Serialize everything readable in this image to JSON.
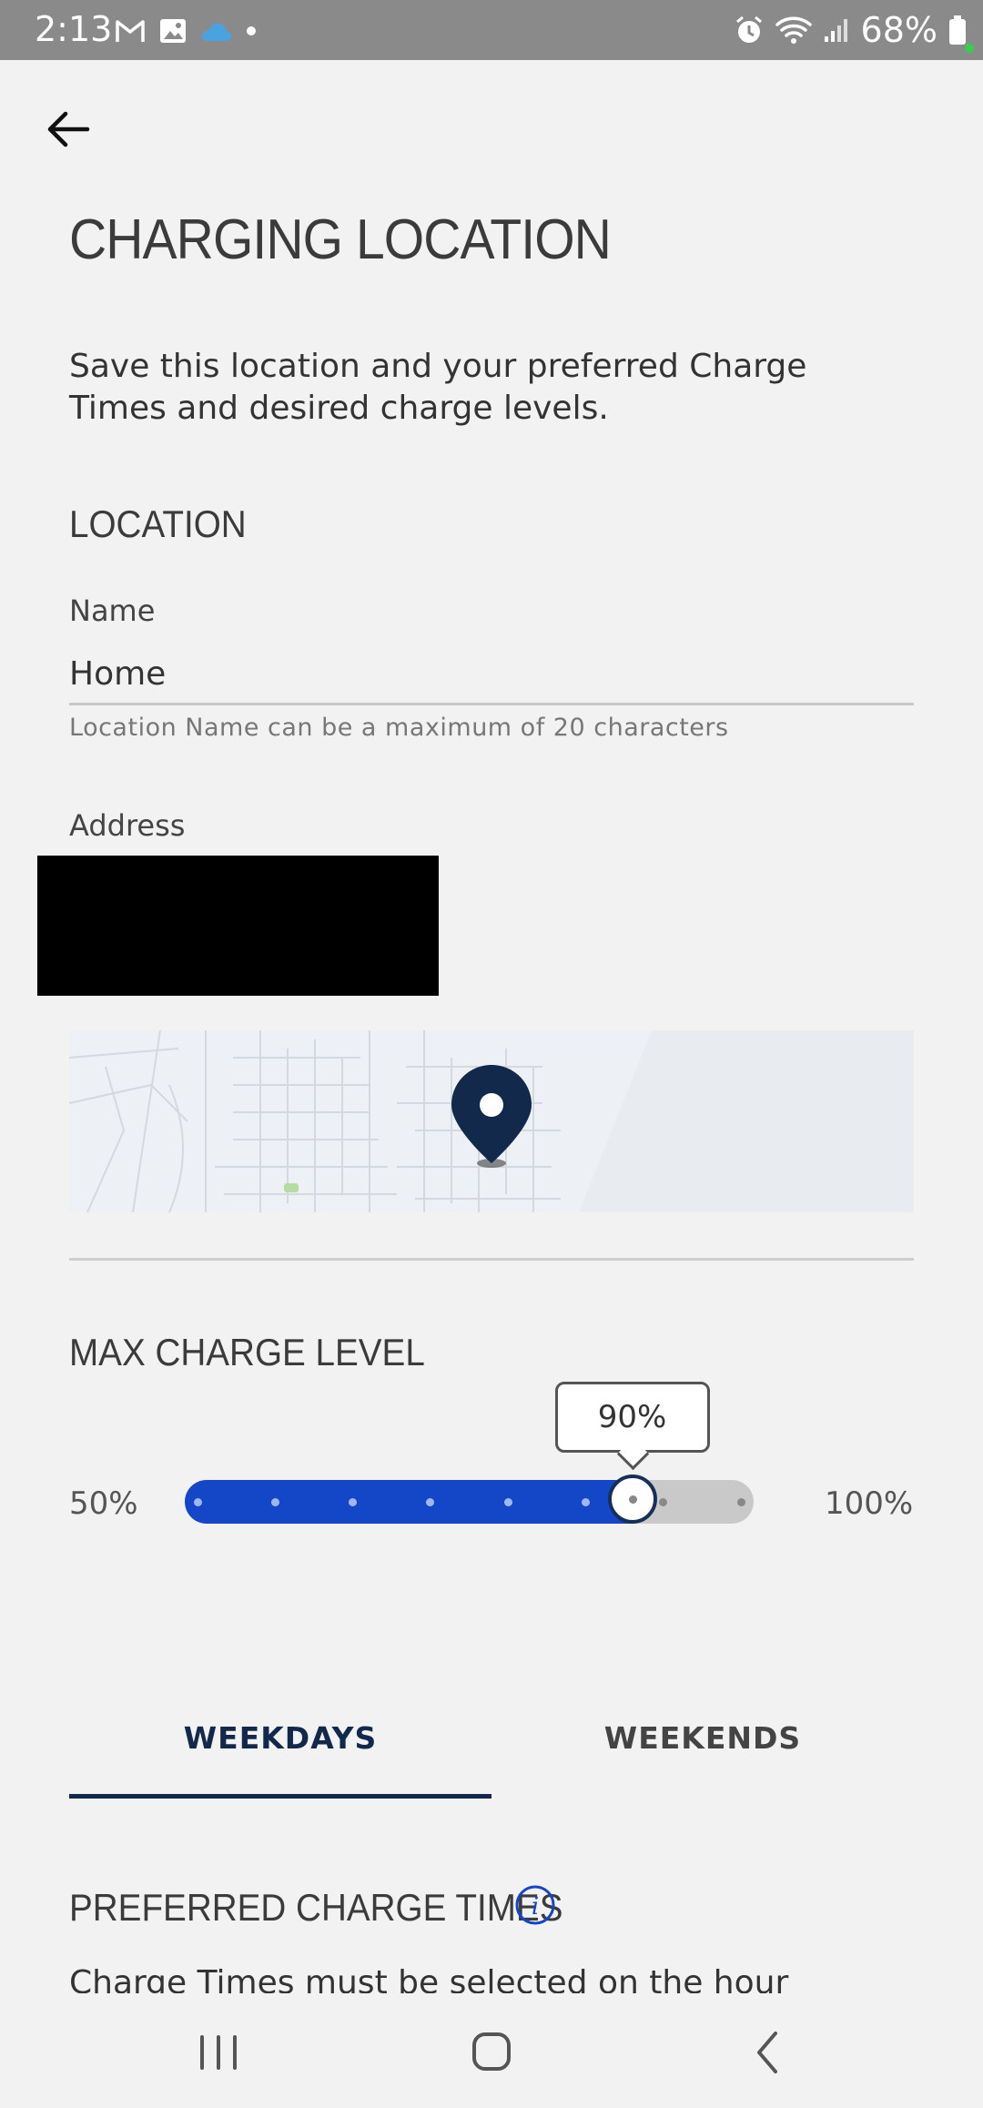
{
  "status_bar": {
    "time": "2:13",
    "battery": "68%",
    "icons": [
      "gmail-icon",
      "gallery-icon",
      "cloud-icon",
      "dot-icon",
      "alarm-icon",
      "wifi-icon",
      "signal-icon",
      "battery-icon"
    ]
  },
  "header": {
    "back_icon": "arrow-left-icon"
  },
  "page": {
    "title": "CHARGING LOCATION",
    "intro": "Save this location and your preferred Charge Times and desired charge levels."
  },
  "location": {
    "section_title": "LOCATION",
    "name_label": "Name",
    "name_value": "Home",
    "name_helper": "Location Name can be a maximum of 20 characters",
    "address_label": "Address"
  },
  "max_charge": {
    "section_title": "MAX CHARGE LEVEL",
    "min_label": "50%",
    "max_label": "100%",
    "value_label": "90%",
    "value": 90,
    "min": 50,
    "max": 100,
    "steps": 8,
    "fill_color": "#1347c8",
    "track_color": "#c9c9c9"
  },
  "tabs": [
    {
      "label": "WEEKDAYS",
      "selected": true
    },
    {
      "label": "WEEKENDS",
      "selected": false
    }
  ],
  "preferred": {
    "section_title": "PREFERRED CHARGE TIMES",
    "note": "Charge Times must be selected on the hour"
  },
  "nav_bar": {
    "buttons": [
      "recents-icon",
      "home-icon",
      "back-icon"
    ]
  }
}
